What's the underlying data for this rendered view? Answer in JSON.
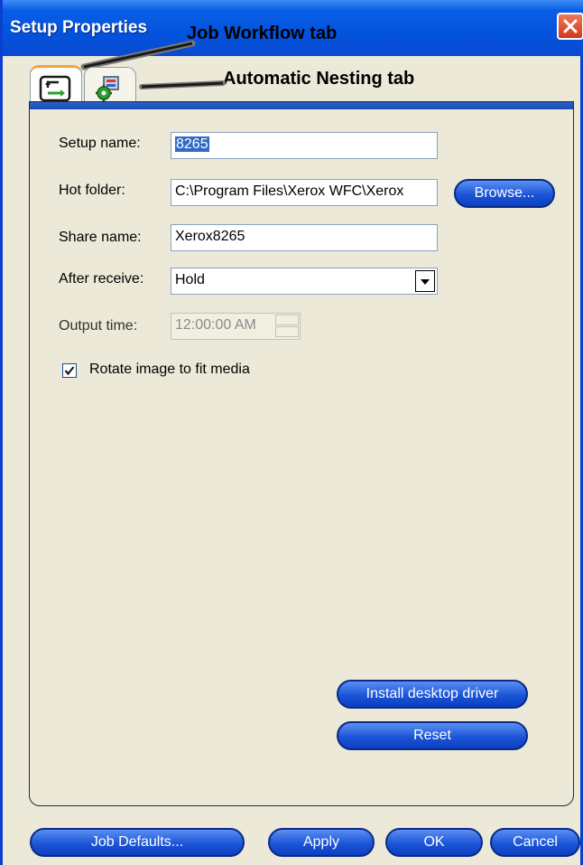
{
  "window": {
    "title": "Setup Properties",
    "accent_color": "#0a5ee6"
  },
  "annotations": {
    "job_workflow_tab": "Job Workflow tab",
    "automatic_nesting_tab": "Automatic Nesting tab"
  },
  "tabs": [
    {
      "name": "Job Workflow",
      "icon": "workflow-arrows-icon",
      "active": true
    },
    {
      "name": "Automatic Nesting",
      "icon": "nesting-gear-icon",
      "active": false
    }
  ],
  "form": {
    "setup_name": {
      "label": "Setup name:",
      "value": "8265"
    },
    "hot_folder": {
      "label": "Hot folder:",
      "value": "C:\\Program Files\\Xerox WFC\\Xerox"
    },
    "browse_label": "Browse...",
    "share_name": {
      "label": "Share name:",
      "value": "Xerox8265"
    },
    "after_receive": {
      "label": "After receive:",
      "value": "Hold"
    },
    "output_time": {
      "label": "Output time:",
      "value": "12:00:00 AM"
    },
    "rotate": {
      "label": "Rotate image to fit media",
      "checked": true
    }
  },
  "panel_buttons": {
    "install_driver": "Install desktop driver",
    "reset": "Reset"
  },
  "footer": {
    "job_defaults": "Job Defaults...",
    "apply": "Apply",
    "ok": "OK",
    "cancel": "Cancel"
  }
}
